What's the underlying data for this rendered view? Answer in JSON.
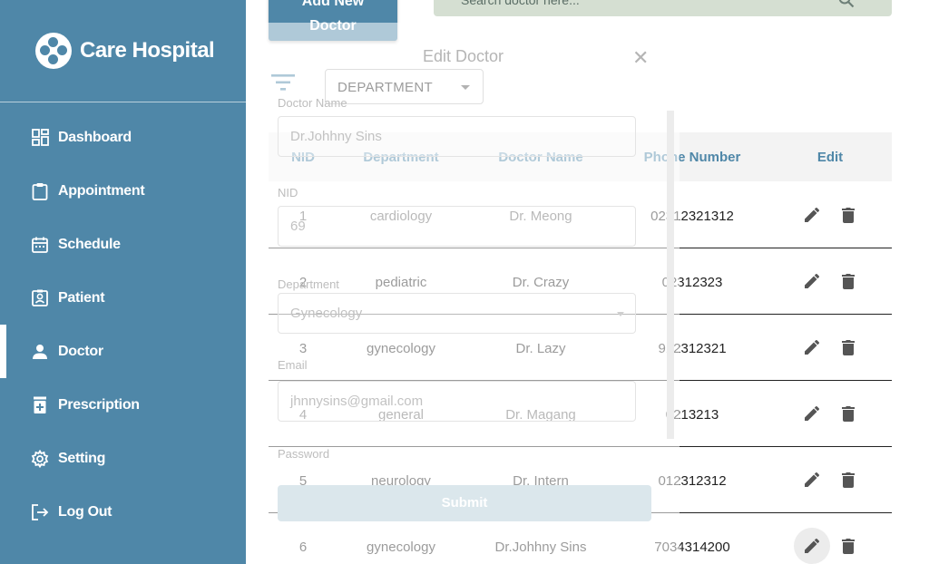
{
  "brand": {
    "name": "Care Hospital"
  },
  "sidebar": {
    "items": [
      {
        "label": "Dashboard",
        "icon": "dashboard-icon"
      },
      {
        "label": "Appointment",
        "icon": "clipboard-icon"
      },
      {
        "label": "Schedule",
        "icon": "calendar-icon"
      },
      {
        "label": "Patient",
        "icon": "id-badge-icon"
      },
      {
        "label": "Doctor",
        "icon": "person-icon",
        "active": true
      },
      {
        "label": "Prescription",
        "icon": "medicine-icon"
      },
      {
        "label": "Setting",
        "icon": "gear-icon"
      },
      {
        "label": "Log Out",
        "icon": "logout-icon"
      }
    ]
  },
  "toolbar": {
    "add_label_line1": "Add New",
    "add_label_line2": "Doctor",
    "search_placeholder": "Search doctor here...",
    "department_filter": "DEPARTMENT"
  },
  "table": {
    "headers": [
      "NID",
      "Department",
      "Doctor Name",
      "Phone Number",
      "Edit"
    ],
    "rows": [
      {
        "nid": "1",
        "department": "cardiology",
        "name": "Dr. Meong",
        "phone": "02312321312"
      },
      {
        "nid": "2",
        "department": "pediatric",
        "name": "Dr. Crazy",
        "phone": "02312323"
      },
      {
        "nid": "3",
        "department": "gynecology",
        "name": "Dr. Lazy",
        "phone": "912312321"
      },
      {
        "nid": "4",
        "department": "general",
        "name": "Dr. Magang",
        "phone": "0213213"
      },
      {
        "nid": "5",
        "department": "neurology",
        "name": "Dr. Intern",
        "phone": "012312312"
      },
      {
        "nid": "6",
        "department": "gynecology",
        "name": "Dr.Johhny Sins",
        "phone": "7034314200"
      }
    ]
  },
  "modal": {
    "title": "Edit Doctor",
    "fields": {
      "doctor_name_label": "Doctor Name",
      "doctor_name_value": "Dr.Johhny Sins",
      "nid_label": "NID",
      "nid_value": "69",
      "department_label": "Department",
      "department_value": "Gynecology",
      "email_label": "Email",
      "email_value": "jhnnysins@gmail.com",
      "password_label": "Password"
    },
    "submit_label": "Submit"
  },
  "colors": {
    "primary": "#4f87a8",
    "search_bg": "#d5dfd2",
    "header_text": "#4f87a8"
  }
}
